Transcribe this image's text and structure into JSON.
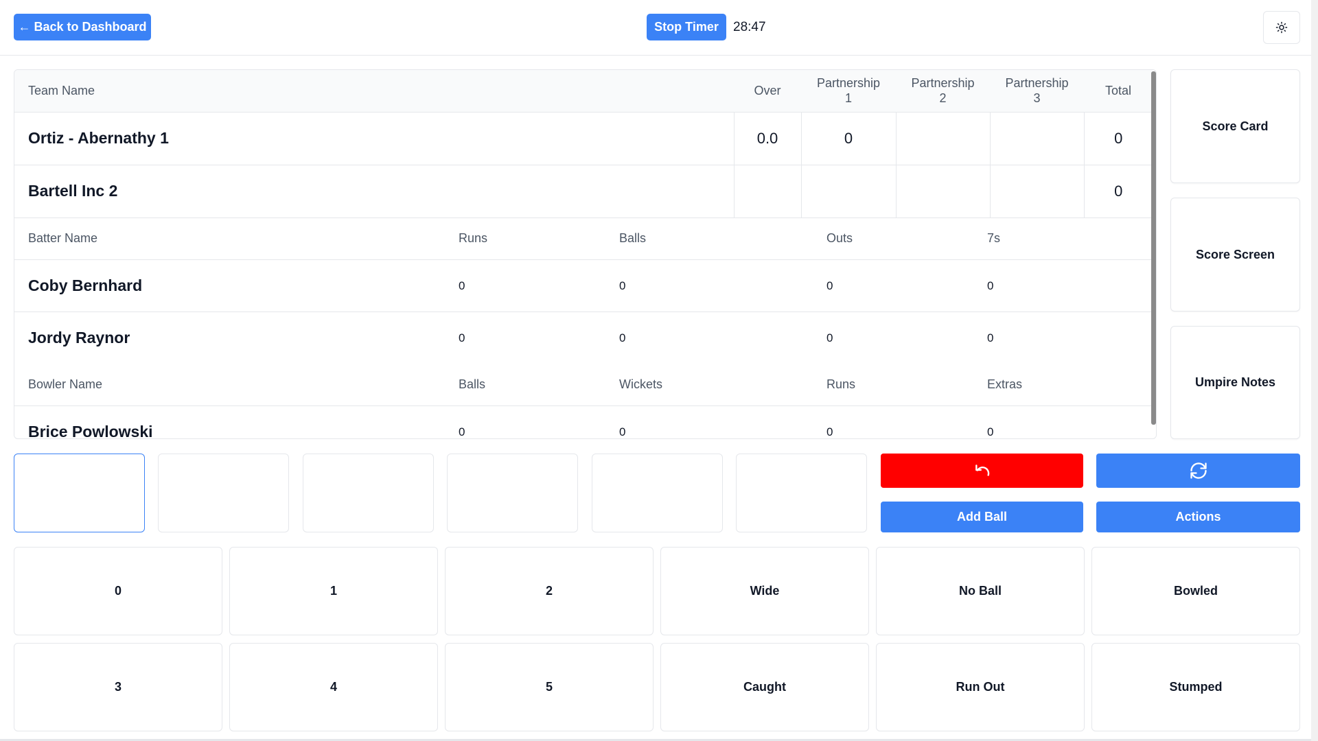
{
  "header": {
    "back_label": "← Back to Dashboard",
    "stop_timer_label": "Stop Timer",
    "timer": "28:47"
  },
  "teams_table": {
    "headers": {
      "team_name": "Team Name",
      "over": "Over",
      "p1_line1": "Partnership",
      "p1_line2": "1",
      "p2_line1": "Partnership",
      "p2_line2": "2",
      "p3_line1": "Partnership",
      "p3_line2": "3",
      "total": "Total"
    },
    "rows": [
      {
        "name": "Ortiz - Abernathy 1",
        "over": "0.0",
        "p1": "0",
        "p2": "",
        "p3": "",
        "total": "0"
      },
      {
        "name": "Bartell Inc 2",
        "over": "",
        "p1": "",
        "p2": "",
        "p3": "",
        "total": "0"
      }
    ]
  },
  "batters_table": {
    "headers": {
      "name": "Batter Name",
      "runs": "Runs",
      "balls": "Balls",
      "outs": "Outs",
      "sevens": "7s"
    },
    "rows": [
      {
        "name": "Coby Bernhard",
        "runs": "0",
        "balls": "0",
        "outs": "0",
        "sevens": "0"
      },
      {
        "name": "Jordy Raynor",
        "runs": "0",
        "balls": "0",
        "outs": "0",
        "sevens": "0"
      }
    ]
  },
  "bowlers_table": {
    "headers": {
      "name": "Bowler Name",
      "balls": "Balls",
      "wickets": "Wickets",
      "runs": "Runs",
      "extras": "Extras"
    },
    "rows": [
      {
        "name": "Brice Powlowski",
        "balls": "0",
        "wickets": "0",
        "runs": "0",
        "extras": "0"
      }
    ]
  },
  "side_buttons": {
    "score_card": "Score Card",
    "score_screen": "Score Screen",
    "umpire_notes": "Umpire Notes"
  },
  "controls": {
    "add_ball": "Add Ball",
    "actions": "Actions",
    "undo_icon": "undo-icon",
    "refresh_icon": "refresh-icon"
  },
  "keypad": [
    "0",
    "1",
    "2",
    "Wide",
    "No Ball",
    "Bowled",
    "3",
    "4",
    "5",
    "Caught",
    "Run Out",
    "Stumped"
  ],
  "colors": {
    "primary": "#3b82f6",
    "danger": "#ff0000",
    "border": "#e5e7eb"
  }
}
